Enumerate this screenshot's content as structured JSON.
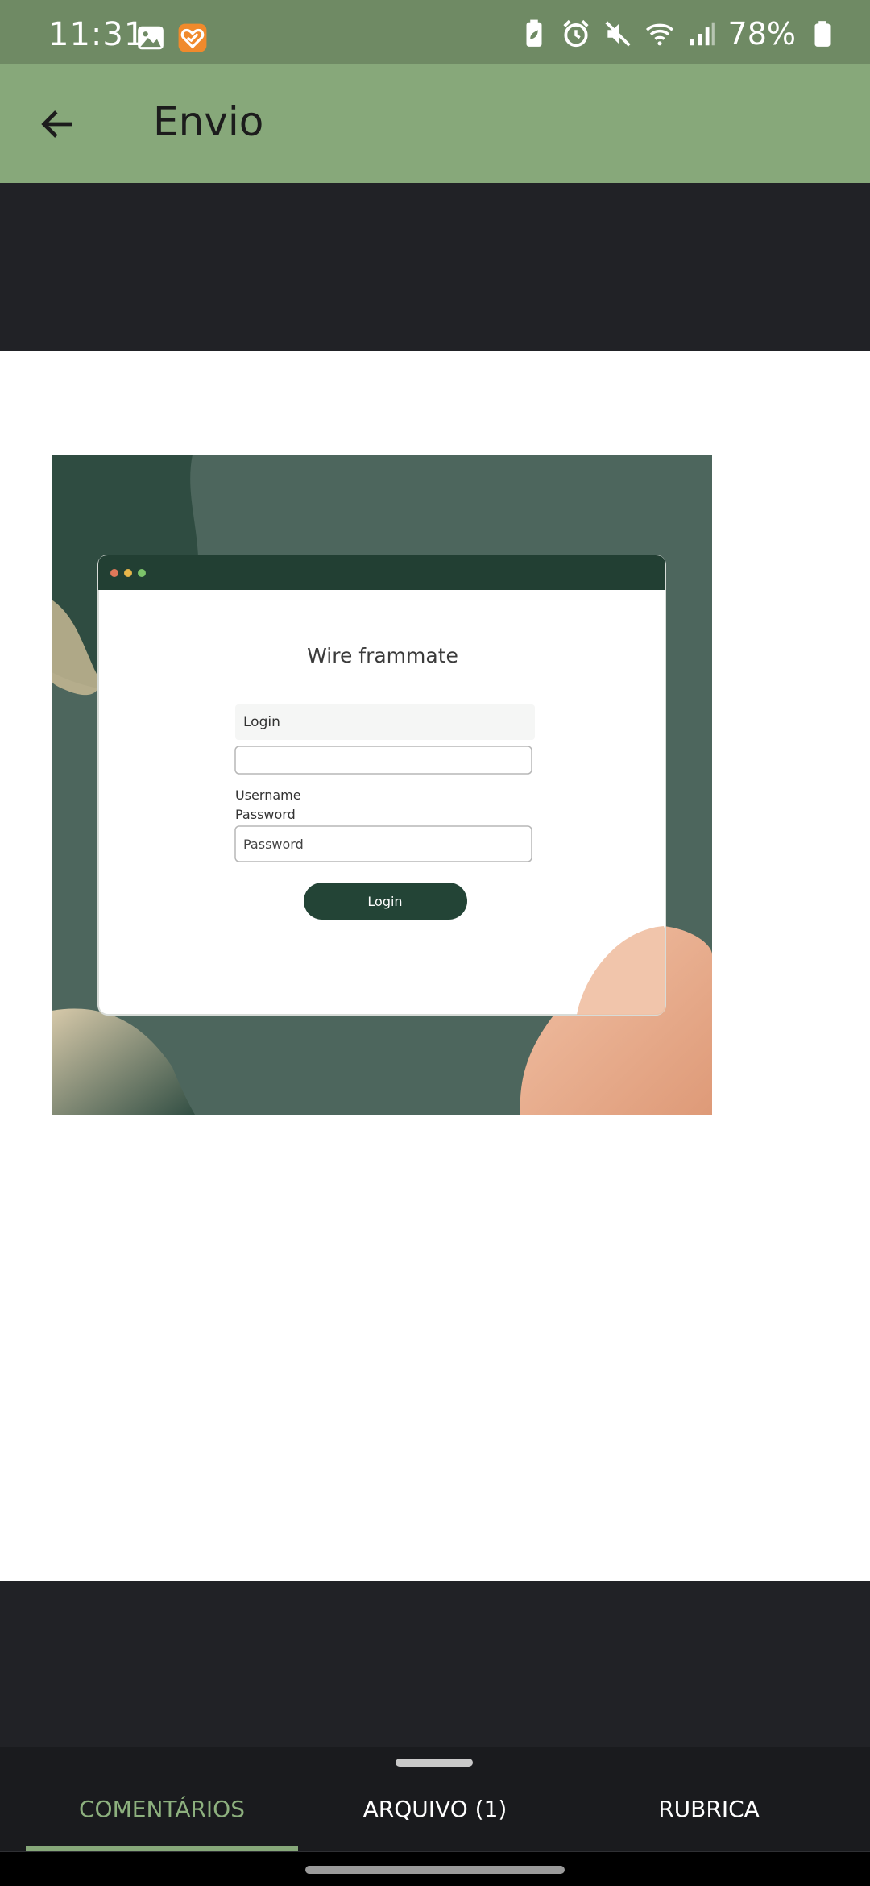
{
  "status_bar": {
    "time": "11:31",
    "battery": "78%",
    "left_icons": [
      "gallery-icon",
      "app-notification-icon"
    ],
    "right_icons": [
      "battery-saver-icon",
      "alarm-icon",
      "mute-icon",
      "wifi-icon",
      "signal-icon",
      "battery-icon"
    ]
  },
  "app_bar": {
    "title": "Envio",
    "back_icon": "arrow-left-icon"
  },
  "attachment": {
    "title": "Wire frammate",
    "login_section": "Login",
    "username_label": "Username",
    "password_label": "Password",
    "password_placeholder": "Password",
    "login_button": "Login"
  },
  "tabs": [
    {
      "label": "COMENTÁRIOS",
      "selected": true
    },
    {
      "label": "ARQUIVO (1)",
      "selected": false
    },
    {
      "label": "RUBRICA",
      "selected": false
    }
  ],
  "colors": {
    "status_bar": "#6f8a64",
    "app_bar": "#87a87a",
    "dark_band": "#212226",
    "tab_active": "#8db07e",
    "attachment_bg": "#4d665d",
    "attachment_header": "#223f33",
    "attachment_button": "#234436"
  }
}
